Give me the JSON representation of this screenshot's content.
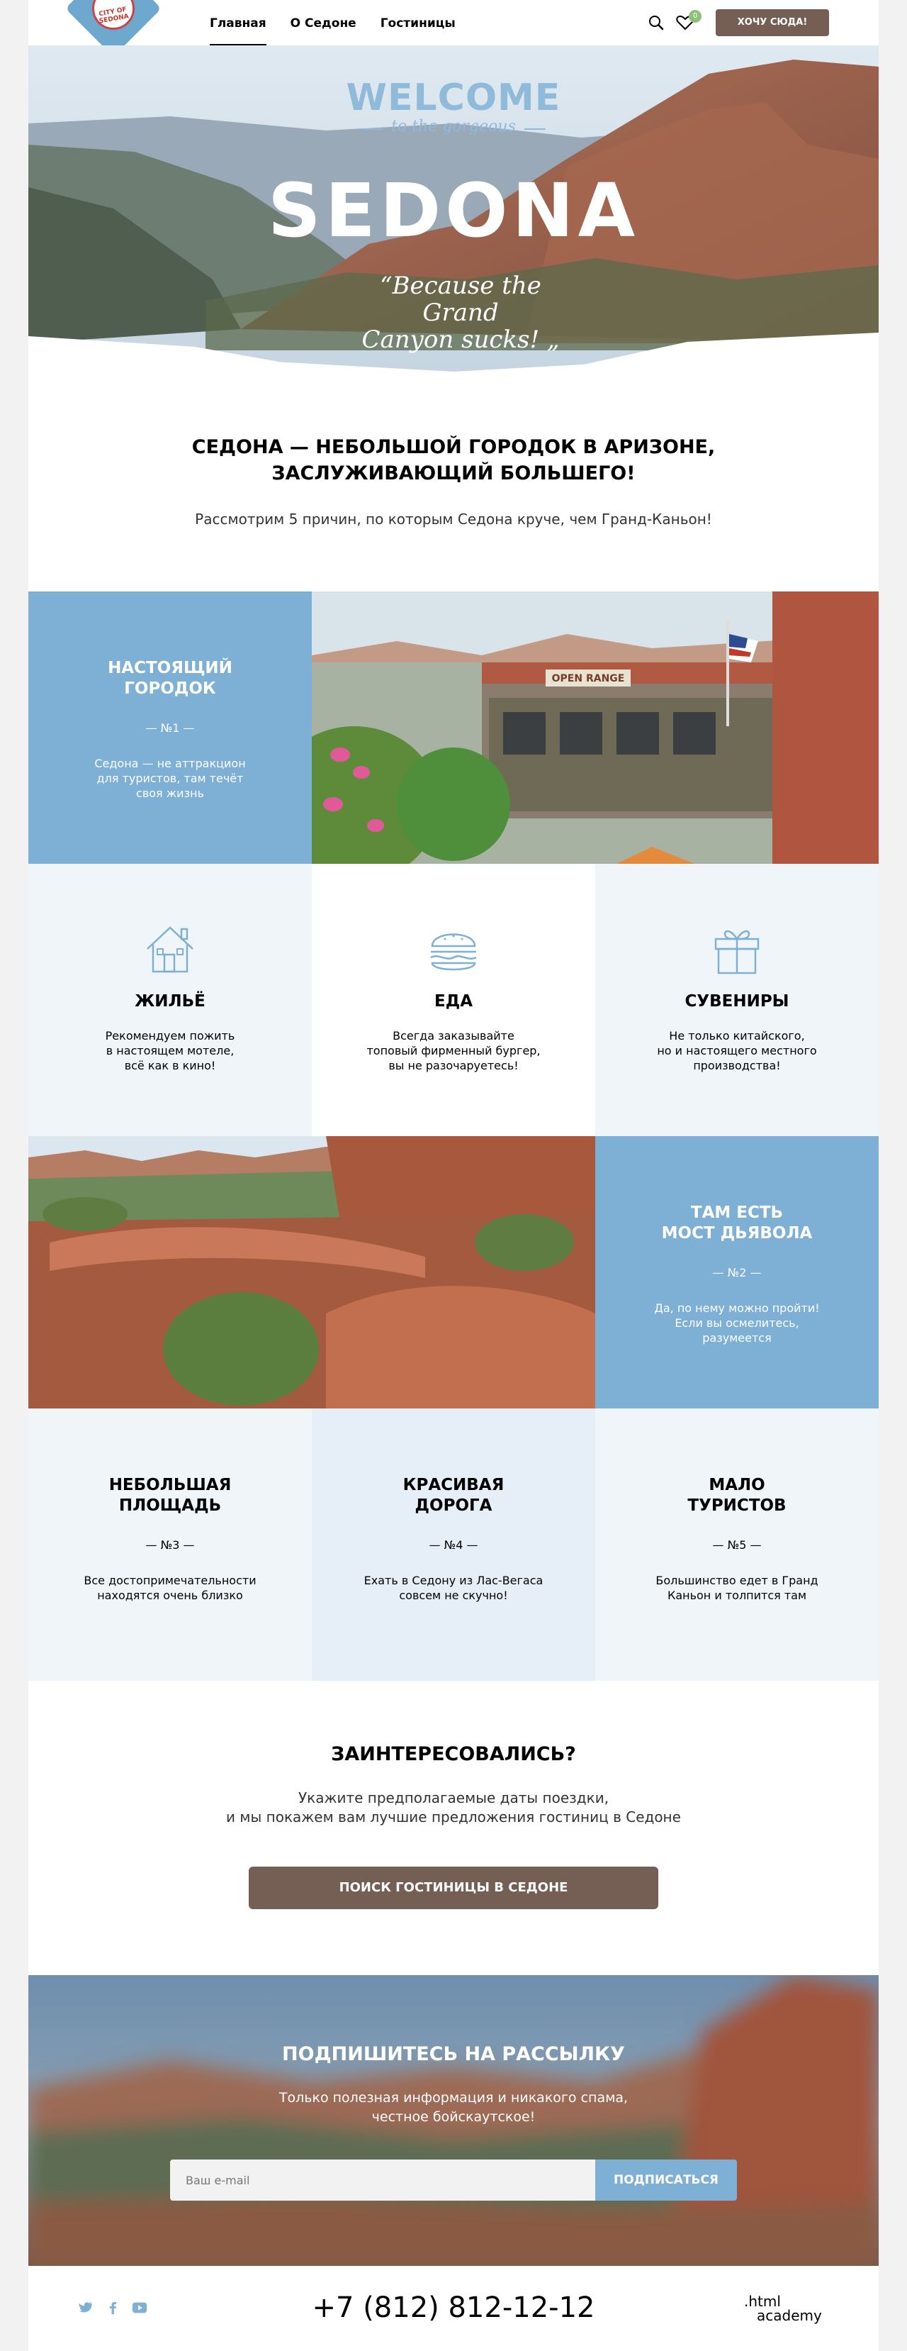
{
  "header": {
    "logo_text": "CITY OF SEDONA",
    "nav": [
      {
        "label": "Главная"
      },
      {
        "label": "О Седоне"
      },
      {
        "label": "Гостиницы"
      }
    ],
    "favorites_count": "0",
    "cta_label": "ХОЧУ СЮДА!"
  },
  "hero": {
    "welcome": "WELCOME",
    "subtitle": "to the gorgeous",
    "title": "SEDONA",
    "quote_line1": "Because the Grand",
    "quote_line2": "Canyon sucks!"
  },
  "intro": {
    "title_line1": "СЕДОНА — НЕБОЛЬШОЙ ГОРОДОК В АРИЗОНЕ,",
    "title_line2": "ЗАСЛУЖИВАЮЩИЙ БОЛЬШЕГО!",
    "text": "Рассмотрим 5 причин, по которым Седона круче, чем Гранд-Каньон!"
  },
  "reasons": [
    {
      "title_line1": "НАСТОЯЩИЙ",
      "title_line2": "ГОРОДОК",
      "number": "— №1 —",
      "text_line1": "Седона — не аттракцион",
      "text_line2": "для туристов, там течёт",
      "text_line3": "своя жизнь"
    },
    {
      "title_line1": "ТАМ ЕСТЬ",
      "title_line2": "МОСТ ДЬЯВОЛА",
      "number": "— №2 —",
      "text_line1": "Да, по нему можно пройти!",
      "text_line2": "Если вы осмелитесь,",
      "text_line3": "разумеется"
    },
    {
      "title_line1": "НЕБОЛЬШАЯ",
      "title_line2": "ПЛОЩАДЬ",
      "number": "— №3 —",
      "text_line1": "Все достопримечательности",
      "text_line2": "находятся очень близко"
    },
    {
      "title_line1": "КРАСИВАЯ",
      "title_line2": "ДОРОГА",
      "number": "— №4 —",
      "text_line1": "Ехать в Седону из Лас-Вегаса",
      "text_line2": "совсем не скучно!"
    },
    {
      "title_line1": "МАЛО",
      "title_line2": "ТУРИСТОВ",
      "number": "— №5 —",
      "text_line1": "Большинство едет в Гранд",
      "text_line2": "Каньон и толпится там"
    }
  ],
  "features": [
    {
      "icon": "house-icon",
      "title": "ЖИЛЬЁ",
      "text_line1": "Рекомендуем пожить",
      "text_line2": "в настоящем мотеле,",
      "text_line3": "всё как в кино!"
    },
    {
      "icon": "burger-icon",
      "title": "ЕДА",
      "text_line1": "Всегда заказывайте",
      "text_line2": "топовый фирменный бургер,",
      "text_line3": "вы не разочаруетесь!"
    },
    {
      "icon": "gift-icon",
      "title": "СУВЕНИРЫ",
      "text_line1": "Не только китайского,",
      "text_line2": "но и настоящего местного",
      "text_line3": "производства!"
    }
  ],
  "photos": {
    "town_sign": "OPEN RANGE"
  },
  "interested": {
    "title": "ЗАИНТЕРЕСОВАЛИСЬ?",
    "text_line1": "Укажите предполагаемые даты поездки,",
    "text_line2": "и мы покажем вам лучшие предложения гостиниц в Седоне",
    "button": "ПОИСК ГОСТИНИЦЫ В СЕДОНЕ"
  },
  "subscribe": {
    "title": "ПОДПИШИТЕСЬ НА РАССЫЛКУ",
    "text_line1": "Только полезная информация и никакого спама,",
    "text_line2": "честное бойскаутское!",
    "placeholder": "Ваш e-mail",
    "button": "ПОДПИСАТЬСЯ"
  },
  "footer": {
    "phone": "+7 (812) 812-12-12",
    "brand_line1": ".html",
    "brand_line2": "academy"
  },
  "colors": {
    "accent_blue": "#7eafd5",
    "brown_button": "#755f55",
    "badge_green": "#8dc07a"
  }
}
